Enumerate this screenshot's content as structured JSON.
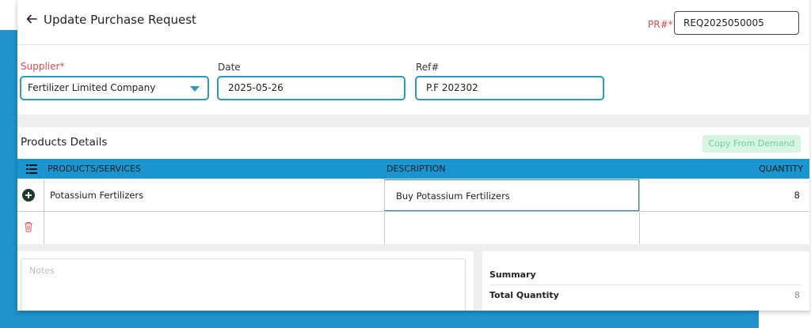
{
  "header": {
    "title": "Update Purchase Request",
    "pr_label": "PR#*",
    "pr_value": "REQ2025050005"
  },
  "form": {
    "supplier_label": "Supplier*",
    "supplier_value": "Fertilizer Limited Company",
    "date_label": "Date",
    "date_value": "2025-05-26",
    "ref_label": "Ref#",
    "ref_value": "P.F 202302"
  },
  "products": {
    "title": "Products Details",
    "copy_button": "Copy From Demand",
    "columns": [
      "PRODUCTS/SERVICES",
      "DESCRIPTION",
      "QUANTITY"
    ],
    "rows": [
      {
        "product": "Potassium Fertilizers",
        "description": "Buy Potassium Fertilizers",
        "quantity": "8"
      },
      {
        "product": "",
        "description": "",
        "quantity": ""
      }
    ]
  },
  "notes": {
    "placeholder": "Notes"
  },
  "summary": {
    "title": "Summary",
    "total_quantity_label": "Total Quantity",
    "total_quantity_value": "8"
  },
  "colors": {
    "accent_blue": "#1996cf",
    "required_red": "#e04848",
    "input_border": "#2a9bb8"
  }
}
